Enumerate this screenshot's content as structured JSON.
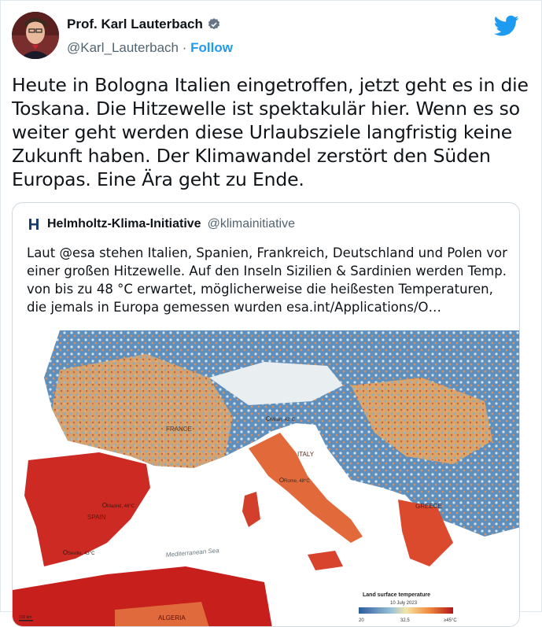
{
  "author": {
    "name": "Prof. Karl Lauterbach",
    "handle": "@Karl_Lauterbach",
    "separator": "·",
    "follow_label": "Follow"
  },
  "tweet": {
    "text": "Heute in Bologna Italien eingetroffen, jetzt geht es in die Toskana. Die Hitzewelle ist spektakulär hier. Wenn es so weiter geht werden diese Urlaubsziele langfristig keine Zukunft haben. Der Klimawandel zerstört den Süden Europas. Eine Ära geht zu Ende."
  },
  "quoted": {
    "name": "Helmholtz-Klima-Initiative",
    "handle": "@klimainitiative",
    "text": "Laut @esa stehen Italien, Spanien, Frankreich, Deutschland und Polen vor einer großen Hitzewelle. Auf den Inseln Sizilien & Sardinien werden Temp. von bis zu 48 °C erwartet, möglicherweise die heißesten Temperaturen, die jemals in Europa gemessen wurden esa.int/Applications/O…"
  },
  "map": {
    "labels": {
      "france": "FRANCE",
      "italy": "ITALY",
      "spain": "SPAIN",
      "greece": "GREECE",
      "algeria": "ALGERIA",
      "sea": "Mediterranean Sea",
      "milan": "Milan, 42°C",
      "rome": "Rome, 48°C",
      "madrid": "Madrid, 46°C",
      "seville": "Seville, 43°C"
    },
    "legend": {
      "title": "Land surface temperature",
      "date": "10 July 2023",
      "min": "20",
      "mid": "32.5",
      "max": "≥45°C"
    },
    "scale": "100 km"
  },
  "colors": {
    "accent": "#1d9bf0",
    "hot": "#d7301f",
    "cool": "#4a7fb5"
  }
}
